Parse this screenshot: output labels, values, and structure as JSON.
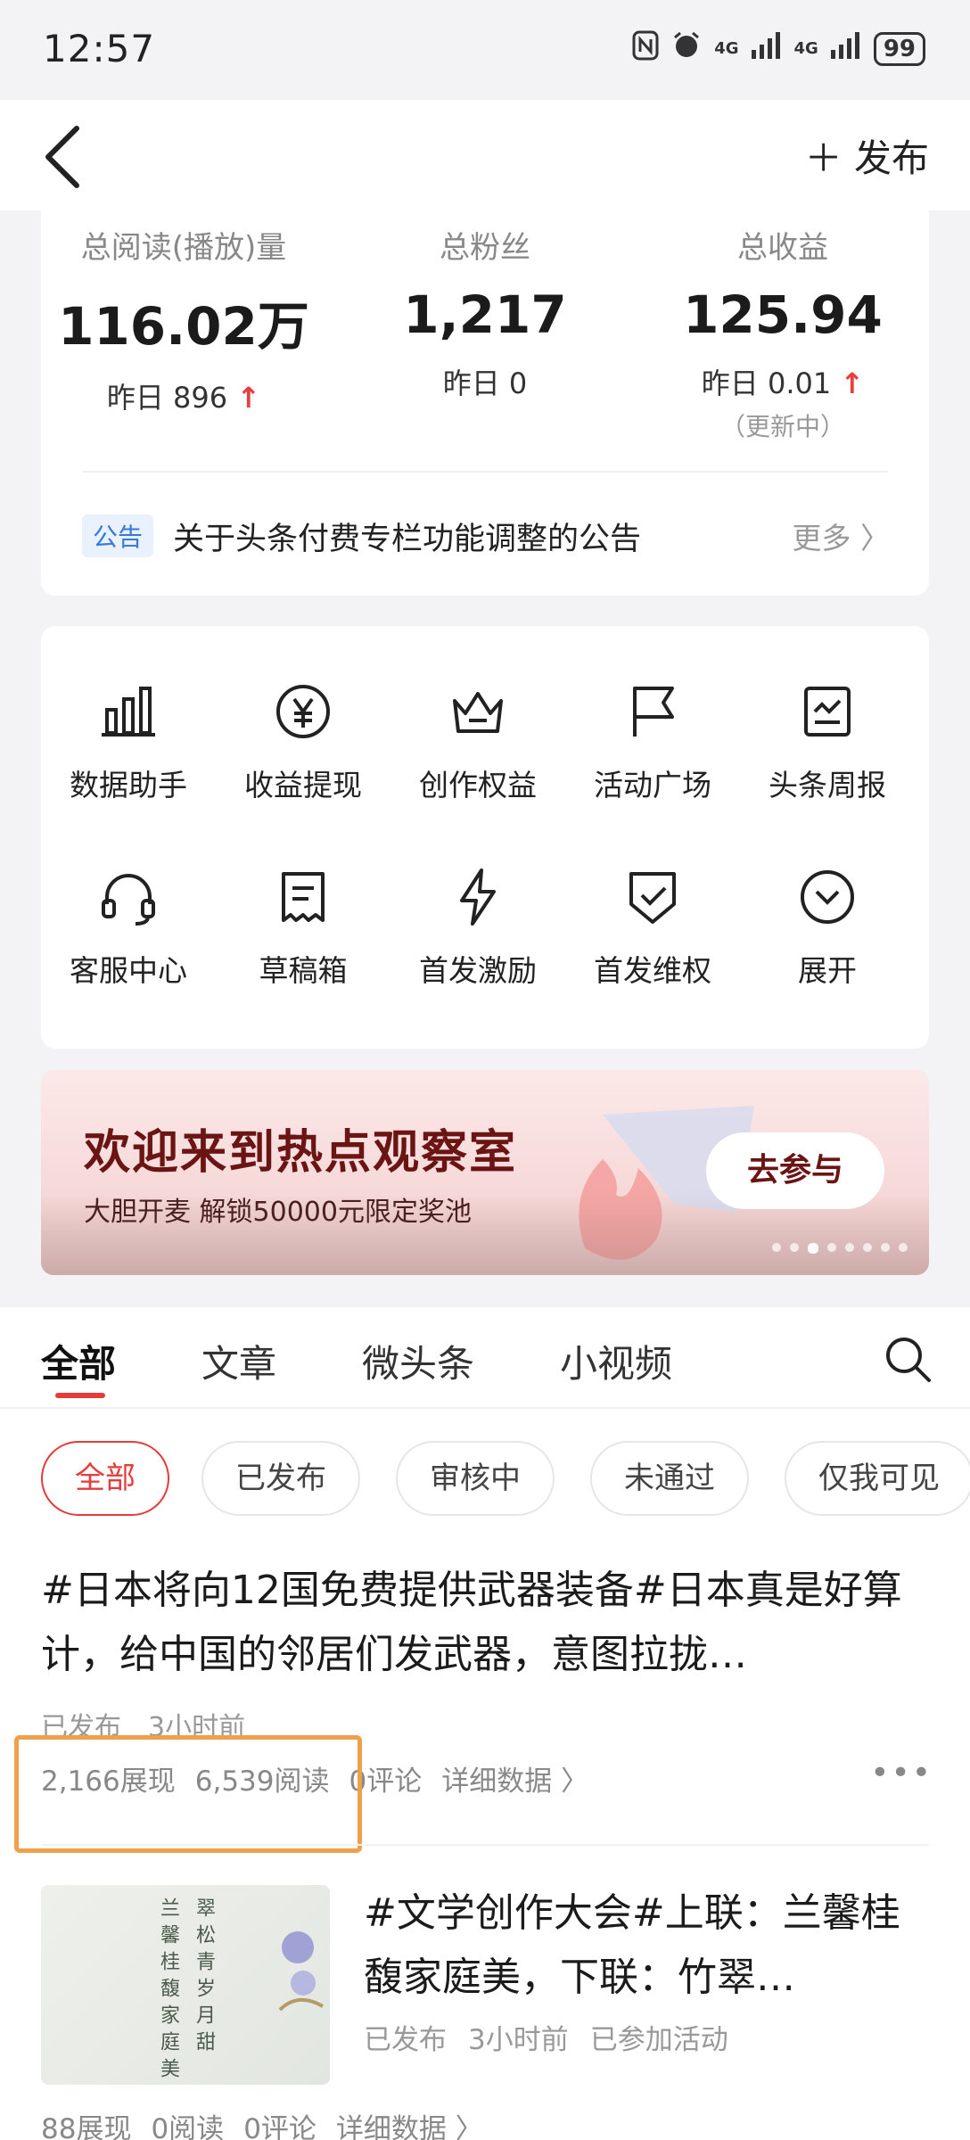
{
  "status_bar": {
    "time": "12:57",
    "network1": "4G",
    "network2": "4G",
    "battery": "99"
  },
  "nav": {
    "publish_label": "＋ 发布"
  },
  "stats": [
    {
      "label": "总阅读(播放)量",
      "value": "116.02万",
      "delta": "昨日 896",
      "trend": "up"
    },
    {
      "label": "总粉丝",
      "value": "1,217",
      "delta": "昨日 0"
    },
    {
      "label": "总收益",
      "value": "125.94",
      "delta": "昨日 0.01",
      "trend": "up",
      "sub": "（更新中）"
    }
  ],
  "notice": {
    "tag": "公告",
    "text": "关于头条付费专栏功能调整的公告",
    "more": "更多 〉"
  },
  "tools": [
    {
      "label": "数据助手",
      "icon": "bar-chart-icon"
    },
    {
      "label": "收益提现",
      "icon": "yuan-coin-icon"
    },
    {
      "label": "创作权益",
      "icon": "crown-icon"
    },
    {
      "label": "活动广场",
      "icon": "flag-icon"
    },
    {
      "label": "头条周报",
      "icon": "report-icon"
    },
    {
      "label": "客服中心",
      "icon": "headset-icon"
    },
    {
      "label": "草稿箱",
      "icon": "draft-icon"
    },
    {
      "label": "首发激励",
      "icon": "lightning-icon"
    },
    {
      "label": "首发维权",
      "icon": "shield-check-icon"
    },
    {
      "label": "展开",
      "icon": "expand-icon"
    }
  ],
  "banner": {
    "title": "欢迎来到热点观察室",
    "subtitle": "大胆开麦 解锁50000元限定奖池",
    "button": "去参与"
  },
  "tabs": [
    "全部",
    "文章",
    "微头条",
    "小视频"
  ],
  "filters": [
    "全部",
    "已发布",
    "审核中",
    "未通过",
    "仅我可见"
  ],
  "posts": [
    {
      "title": "#日本将向12国免费提供武器装备#日本真是好算计，给中国的邻居们发武器，意图拉拢…",
      "meta": "已发布　3小时前",
      "impressions": "2,166展现",
      "reads": "6,539阅读",
      "comments": "0评论",
      "detail": "详细数据 〉"
    },
    {
      "title": "#文学创作大会#上联：兰馨桂馥家庭美，下联：竹翠…",
      "status": "已发布",
      "time": "3小时前",
      "activity": "已参加活动",
      "impressions": "88展现",
      "reads": "0阅读",
      "comments": "0评论",
      "detail": "详细数据 〉",
      "thumb_text_1": "兰馨桂馥家庭美",
      "thumb_text_2": "翠松青岁月甜"
    }
  ]
}
